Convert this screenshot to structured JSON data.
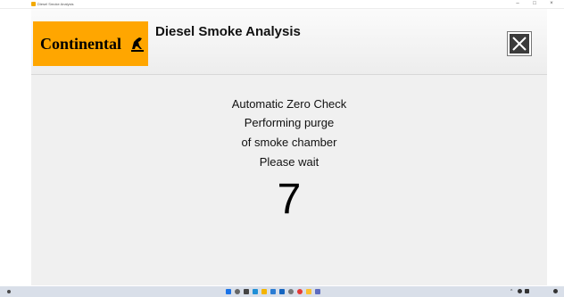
{
  "window": {
    "title": "Diesel Smoke Analysis",
    "minimize_glyph": "–",
    "maximize_glyph": "□",
    "close_glyph": "×"
  },
  "header": {
    "logo_text": "Continental",
    "logo_brand_color": "#ffa600",
    "title": "Diesel Smoke Analysis",
    "close_icon": "close-icon"
  },
  "content": {
    "lines": [
      "Automatic Zero Check",
      "Performing purge",
      "of smoke chamber",
      "Please wait"
    ],
    "countdown": "7"
  },
  "taskbar": {
    "icons": [
      "windows-start-icon",
      "search-icon",
      "task-view-icon",
      "edge-icon",
      "file-explorer-icon",
      "store-icon",
      "mail-icon",
      "settings-icon",
      "chrome-icon",
      "folder-icon",
      "app-icon"
    ],
    "tray": [
      "chevron-up-icon",
      "network-icon",
      "volume-icon",
      "notification-icon"
    ]
  },
  "colors": {
    "content_bg": "#f0f0f0",
    "close_button_bg": "#3b3b3b",
    "taskbar_bg": "#d9dfe9"
  }
}
